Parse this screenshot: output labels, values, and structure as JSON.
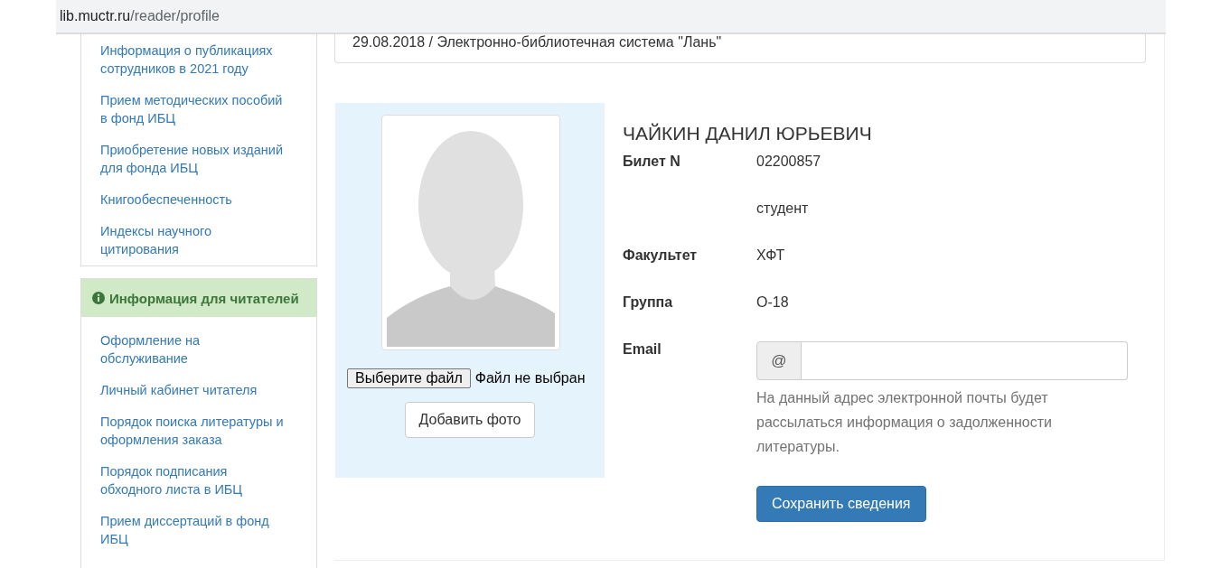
{
  "address_bar": {
    "host": "lib.muctr.ru",
    "path": "/reader/profile"
  },
  "sidebar": {
    "panels": [
      {
        "items": [
          "Информация о публикациях сотрудников в 2021 году",
          "Прием методических пособий в фонд ИБЦ",
          "Приобретение новых изданий для фонда ИБЦ",
          "Книгообеспеченность",
          "Индексы научного цитирования"
        ]
      },
      {
        "heading": "Информация для читателей",
        "items": [
          "Оформление на обслуживание",
          "Личный кабинет читателя",
          "Порядок поиска литературы и оформления заказа",
          "Порядок подписания обходного листа в ИБЦ",
          "Прием диссертаций в фонд ИБЦ"
        ]
      }
    ]
  },
  "news": {
    "text": "29.08.2018 / Электронно-библиотечная система \"Лань\""
  },
  "photo": {
    "file_button": "Выберите файл",
    "file_status": "Файл не выбран",
    "add_button": "Добавить фото"
  },
  "profile": {
    "name": "ЧАЙКИН ДАНИЛ ЮРЬЕВИЧ",
    "fields": [
      {
        "label": "Билет N",
        "value": "02200857"
      },
      {
        "value": "студент"
      },
      {
        "label": "Факультет",
        "value": "ХФТ"
      },
      {
        "label": "Группа",
        "value": "О-18"
      }
    ],
    "email": {
      "label": "Email",
      "addon": "@",
      "help": "На данный адрес электронной почты будет рассылаться информация о задолженности литературы."
    },
    "save_button": "Сохранить сведения"
  }
}
